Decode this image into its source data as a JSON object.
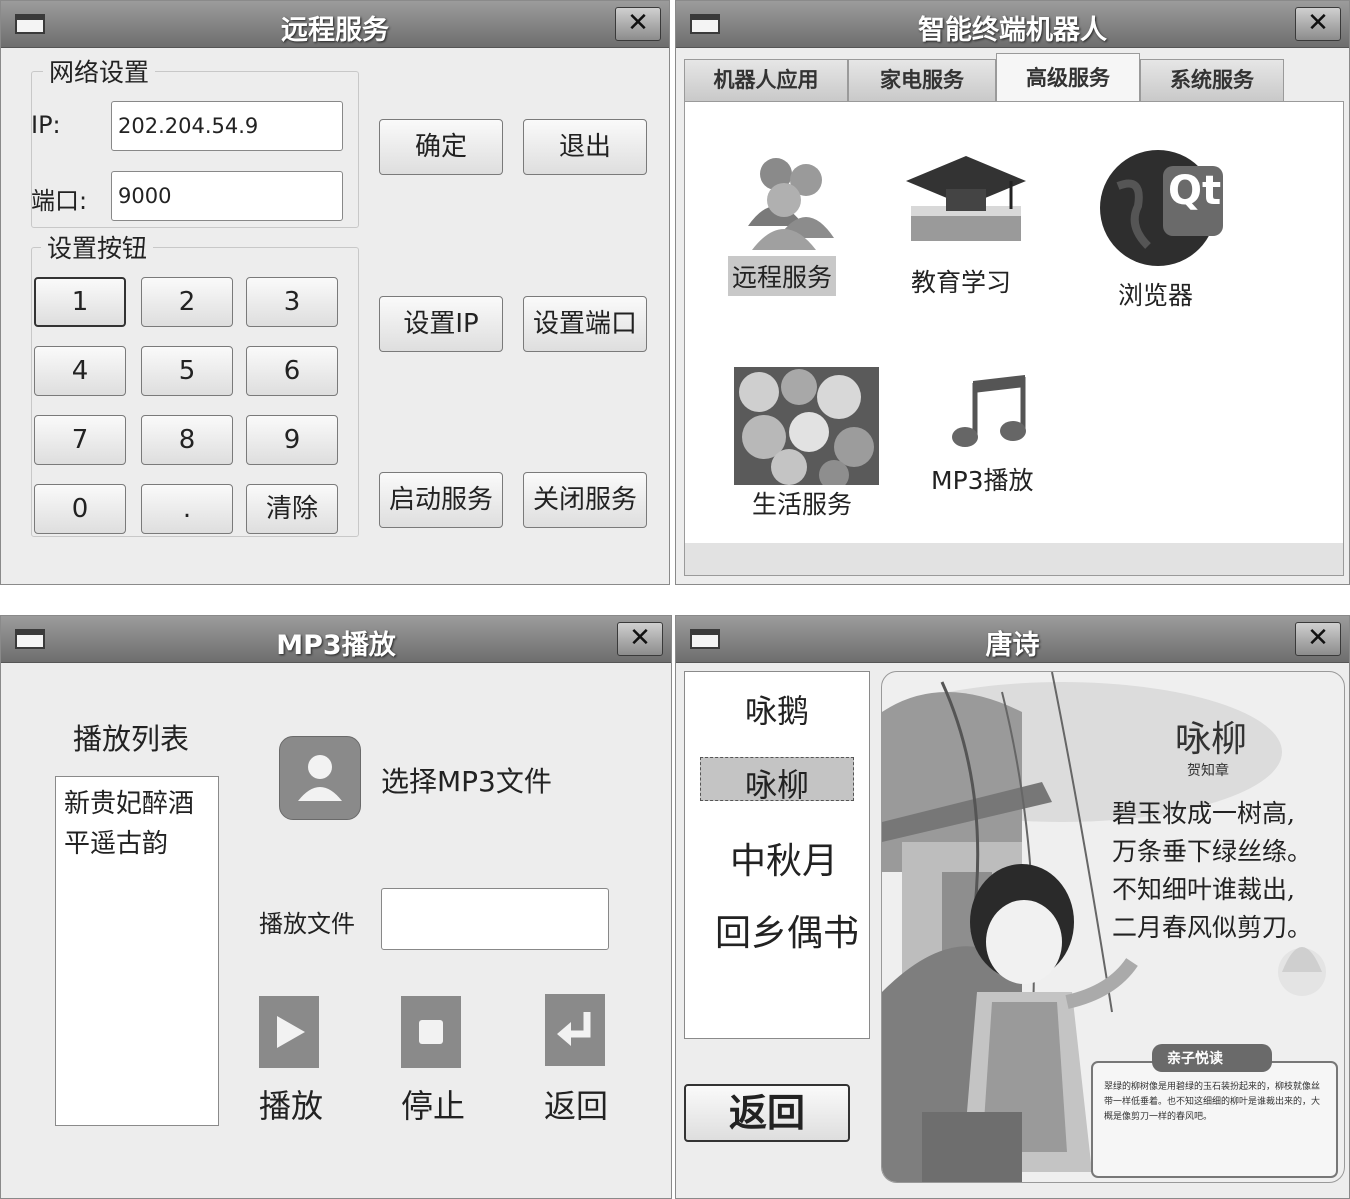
{
  "remote": {
    "title": "远程服务",
    "group_network": "网络设置",
    "ip_label": "IP:",
    "ip_value": "202.204.54.9",
    "port_label": "端口:",
    "port_value": "9000",
    "group_keys": "设置按钮",
    "keys": [
      "1",
      "2",
      "3",
      "4",
      "5",
      "6",
      "7",
      "8",
      "9",
      "0",
      ".",
      "清除"
    ],
    "btn_ok": "确定",
    "btn_exit": "退出",
    "btn_set_ip": "设置IP",
    "btn_set_port": "设置端口",
    "btn_start": "启动服务",
    "btn_stop": "关闭服务"
  },
  "robot": {
    "title": "智能终端机器人",
    "tabs": [
      "机器人应用",
      "家电服务",
      "高级服务",
      "系统服务"
    ],
    "active_tab": "高级服务",
    "apps": [
      "远程服务",
      "教育学习",
      "浏览器",
      "生活服务",
      "MP3播放"
    ],
    "qt_logo_text": "Qt"
  },
  "mp3": {
    "title": "MP3播放",
    "playlist_label": "播放列表",
    "playlist": [
      "新贵妃醉酒",
      "平遥古韵"
    ],
    "select_label": "选择MP3文件",
    "file_label": "播放文件",
    "file_value": "",
    "play_label": "播放",
    "stop_label": "停止",
    "back_label": "返回"
  },
  "poem": {
    "title": "唐诗",
    "list": [
      "咏鹅",
      "咏柳",
      "中秋月",
      "回乡偶书"
    ],
    "selected": "咏柳",
    "back_button": "返回",
    "poem_title": "咏柳",
    "author": "贺知章",
    "lines": [
      "碧玉妆成一树高,",
      "万条垂下绿丝绦。",
      "不知细叶谁裁出,",
      "二月春风似剪刀。"
    ],
    "note_title": "亲子悦读",
    "note_text": "翠绿的柳树像是用碧绿的玉石装扮起来的，柳枝就像丝带一样低垂着。也不知这细细的柳叶是谁裁出来的，大概是像剪刀一样的春风吧。"
  }
}
